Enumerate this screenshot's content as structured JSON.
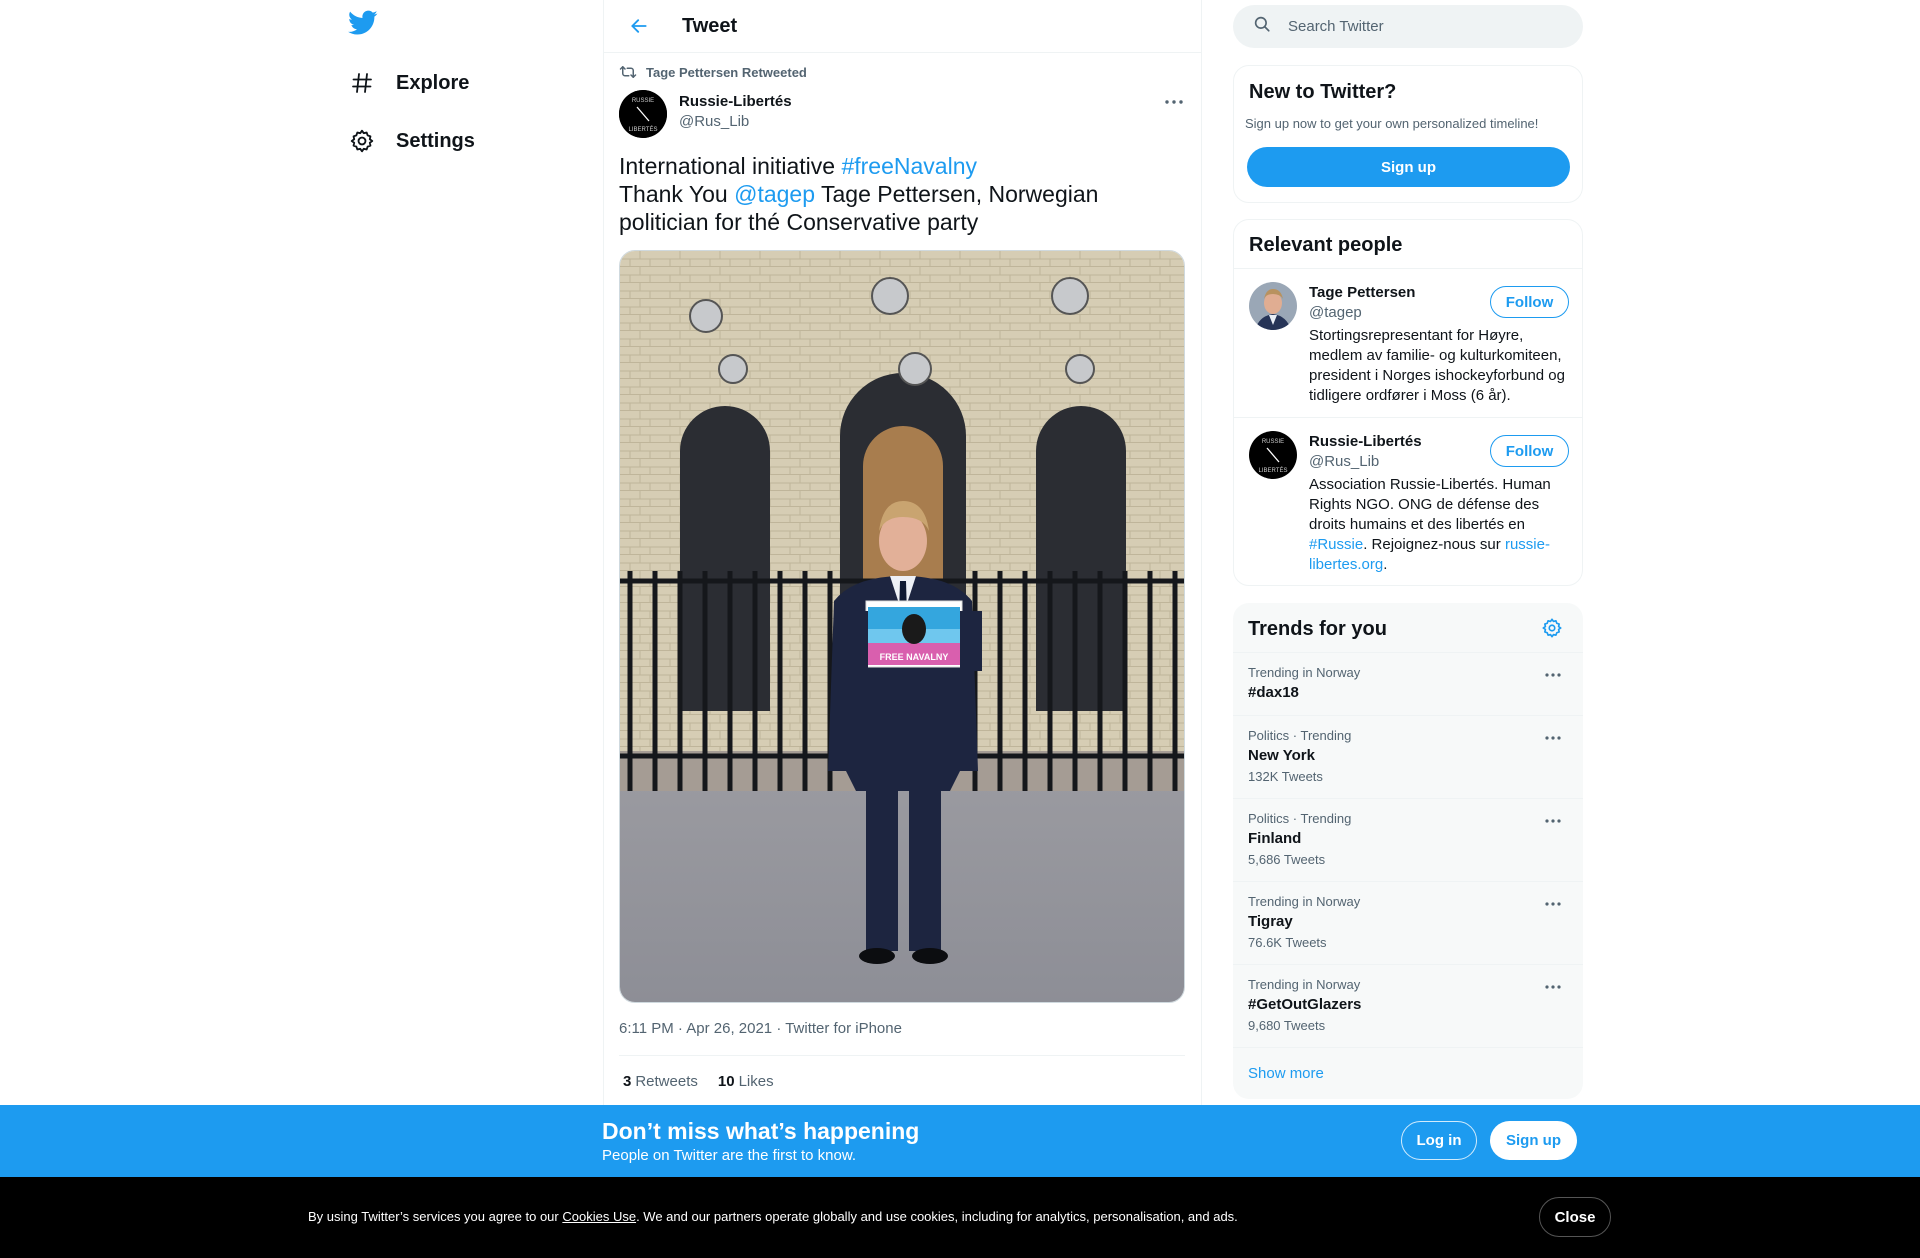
{
  "nav": {
    "explore_label": "Explore",
    "settings_label": "Settings"
  },
  "header": {
    "title": "Tweet"
  },
  "tweet": {
    "retweeted_by": "Tage Pettersen Retweeted",
    "author_name": "Russie-Libertés",
    "author_handle": "@Rus_Lib",
    "text_part1": "International initiative ",
    "hashtag": "#freeNavalny",
    "text_part2": "Thank You ",
    "mention": "@tagep",
    "text_part3": " Tage Pettersen, Norwegian politician for thé Conservative party",
    "photo_sign_text": "FREE NAVALNY",
    "timestamp": "6:11 PM · Apr 26, 2021",
    "separator": " · ",
    "source": "Twitter for iPhone",
    "retweets_count": "3",
    "retweets_label": "Retweets",
    "likes_count": "10",
    "likes_label": "Likes"
  },
  "search": {
    "placeholder": "Search Twitter"
  },
  "new_to_twitter": {
    "title": "New to Twitter?",
    "subtitle": "Sign up now to get your own personalized timeline!",
    "signup_label": "Sign up"
  },
  "relevant_people": {
    "title": "Relevant people",
    "people": [
      {
        "name": "Tage Pettersen",
        "handle": "@tagep",
        "follow_label": "Follow",
        "bio": "Stortingsrepresentant for Høyre, medlem av familie- og kulturkomiteen, president i Norges ishockeyforbund og tidligere ordfører i Moss (6 år)."
      },
      {
        "name": "Russie-Libertés",
        "handle": "@Rus_Lib",
        "follow_label": "Follow",
        "bio_part1": "Association Russie-Libertés. Human Rights NGO. ONG de défense des droits humains et des libertés en ",
        "bio_hashtag": "#Russie",
        "bio_part2": ". Rejoignez-nous sur ",
        "bio_link": "russie-libertes.org",
        "bio_part3": "."
      }
    ]
  },
  "trends": {
    "title": "Trends for you",
    "items": [
      {
        "context": "Trending in Norway",
        "name": "#dax18",
        "count": ""
      },
      {
        "context": "Politics · Trending",
        "name": "New York",
        "count": "132K Tweets"
      },
      {
        "context": "Politics · Trending",
        "name": "Finland",
        "count": "5,686 Tweets"
      },
      {
        "context": "Trending in Norway",
        "name": "Tigray",
        "count": "76.6K Tweets"
      },
      {
        "context": "Trending in Norway",
        "name": "#GetOutGlazers",
        "count": "9,680 Tweets"
      }
    ],
    "show_more_label": "Show more"
  },
  "cta": {
    "title": "Don’t miss what’s happening",
    "subtitle": "People on Twitter are the first to know.",
    "login_label": "Log in",
    "signup_label": "Sign up"
  },
  "cookie": {
    "text_before": "By using Twitter’s services you agree to our ",
    "link_label": "Cookies Use",
    "text_after": ". We and our partners operate globally and use cookies, including for analytics, personalisation, and ads.",
    "close_label": "Close"
  },
  "colors": {
    "accent": "#1d9bf0",
    "text_primary": "#0f1419",
    "text_secondary": "#536471",
    "cookie_bar": "#000000"
  }
}
